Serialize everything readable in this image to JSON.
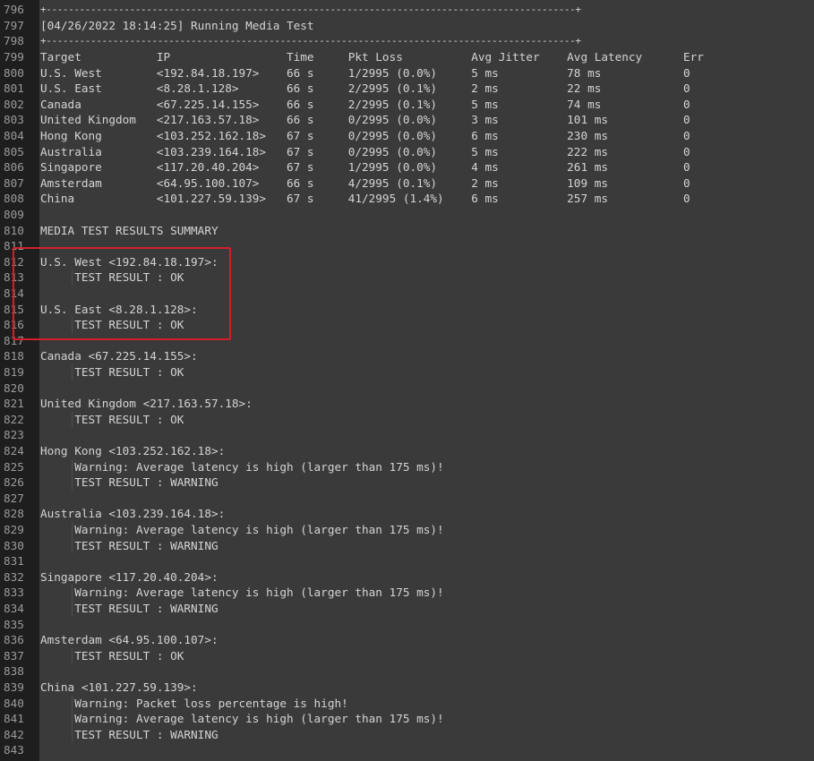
{
  "log": {
    "lines": [
      {
        "num": "796",
        "text": "+-----------------------------------------------------------------------------------------------+",
        "kind": "border"
      },
      {
        "num": "797",
        "text": "[04/26/2022 18:14:25] Running Media Test"
      },
      {
        "num": "798",
        "text": "+-----------------------------------------------------------------------------------------------+",
        "kind": "border"
      },
      {
        "num": "799",
        "text": "Target           IP                 Time     Pkt Loss          Avg Jitter    Avg Latency      Err"
      },
      {
        "num": "800",
        "text": "U.S. West        <192.84.18.197>    66 s     1/2995 (0.0%)     5 ms          78 ms            0"
      },
      {
        "num": "801",
        "text": "U.S. East        <8.28.1.128>       66 s     2/2995 (0.1%)     2 ms          22 ms            0"
      },
      {
        "num": "802",
        "text": "Canada           <67.225.14.155>    66 s     2/2995 (0.1%)     5 ms          74 ms            0"
      },
      {
        "num": "803",
        "text": "United Kingdom   <217.163.57.18>    66 s     0/2995 (0.0%)     3 ms          101 ms           0"
      },
      {
        "num": "804",
        "text": "Hong Kong        <103.252.162.18>   67 s     0/2995 (0.0%)     6 ms          230 ms           0"
      },
      {
        "num": "805",
        "text": "Australia        <103.239.164.18>   67 s     0/2995 (0.0%)     5 ms          222 ms           0"
      },
      {
        "num": "806",
        "text": "Singapore        <117.20.40.204>    67 s     1/2995 (0.0%)     4 ms          261 ms           0"
      },
      {
        "num": "807",
        "text": "Amsterdam        <64.95.100.107>    66 s     4/2995 (0.1%)     2 ms          109 ms           0"
      },
      {
        "num": "808",
        "text": "China            <101.227.59.139>   67 s     41/2995 (1.4%)    6 ms          257 ms           0"
      },
      {
        "num": "809",
        "text": ""
      },
      {
        "num": "810",
        "text": "MEDIA TEST RESULTS SUMMARY"
      },
      {
        "num": "811",
        "text": ""
      },
      {
        "num": "812",
        "text": "U.S. West <192.84.18.197>:"
      },
      {
        "num": "813",
        "text": "     TEST RESULT : OK"
      },
      {
        "num": "814",
        "text": ""
      },
      {
        "num": "815",
        "text": "U.S. East <8.28.1.128>:"
      },
      {
        "num": "816",
        "text": "     TEST RESULT : OK"
      },
      {
        "num": "817",
        "text": ""
      },
      {
        "num": "818",
        "text": "Canada <67.225.14.155>:"
      },
      {
        "num": "819",
        "text": "     TEST RESULT : OK"
      },
      {
        "num": "820",
        "text": ""
      },
      {
        "num": "821",
        "text": "United Kingdom <217.163.57.18>:"
      },
      {
        "num": "822",
        "text": "     TEST RESULT : OK"
      },
      {
        "num": "823",
        "text": ""
      },
      {
        "num": "824",
        "text": "Hong Kong <103.252.162.18>:"
      },
      {
        "num": "825",
        "text": "     Warning: Average latency is high (larger than 175 ms)!"
      },
      {
        "num": "826",
        "text": "     TEST RESULT : WARNING"
      },
      {
        "num": "827",
        "text": ""
      },
      {
        "num": "828",
        "text": "Australia <103.239.164.18>:"
      },
      {
        "num": "829",
        "text": "     Warning: Average latency is high (larger than 175 ms)!"
      },
      {
        "num": "830",
        "text": "     TEST RESULT : WARNING"
      },
      {
        "num": "831",
        "text": ""
      },
      {
        "num": "832",
        "text": "Singapore <117.20.40.204>:"
      },
      {
        "num": "833",
        "text": "     Warning: Average latency is high (larger than 175 ms)!"
      },
      {
        "num": "834",
        "text": "     TEST RESULT : WARNING"
      },
      {
        "num": "835",
        "text": ""
      },
      {
        "num": "836",
        "text": "Amsterdam <64.95.100.107>:"
      },
      {
        "num": "837",
        "text": "     TEST RESULT : OK"
      },
      {
        "num": "838",
        "text": ""
      },
      {
        "num": "839",
        "text": "China <101.227.59.139>:"
      },
      {
        "num": "840",
        "text": "     Warning: Packet loss percentage is high!"
      },
      {
        "num": "841",
        "text": "     Warning: Average latency is high (larger than 175 ms)!"
      },
      {
        "num": "842",
        "text": "     TEST RESULT : WARNING"
      },
      {
        "num": "843",
        "text": ""
      }
    ]
  },
  "colors": {
    "background": "#3a3a3a",
    "gutter": "#1e1e1e",
    "line_number": "#9a9a9a",
    "text": "#d4d4d4",
    "highlight_border": "#d0202a"
  }
}
